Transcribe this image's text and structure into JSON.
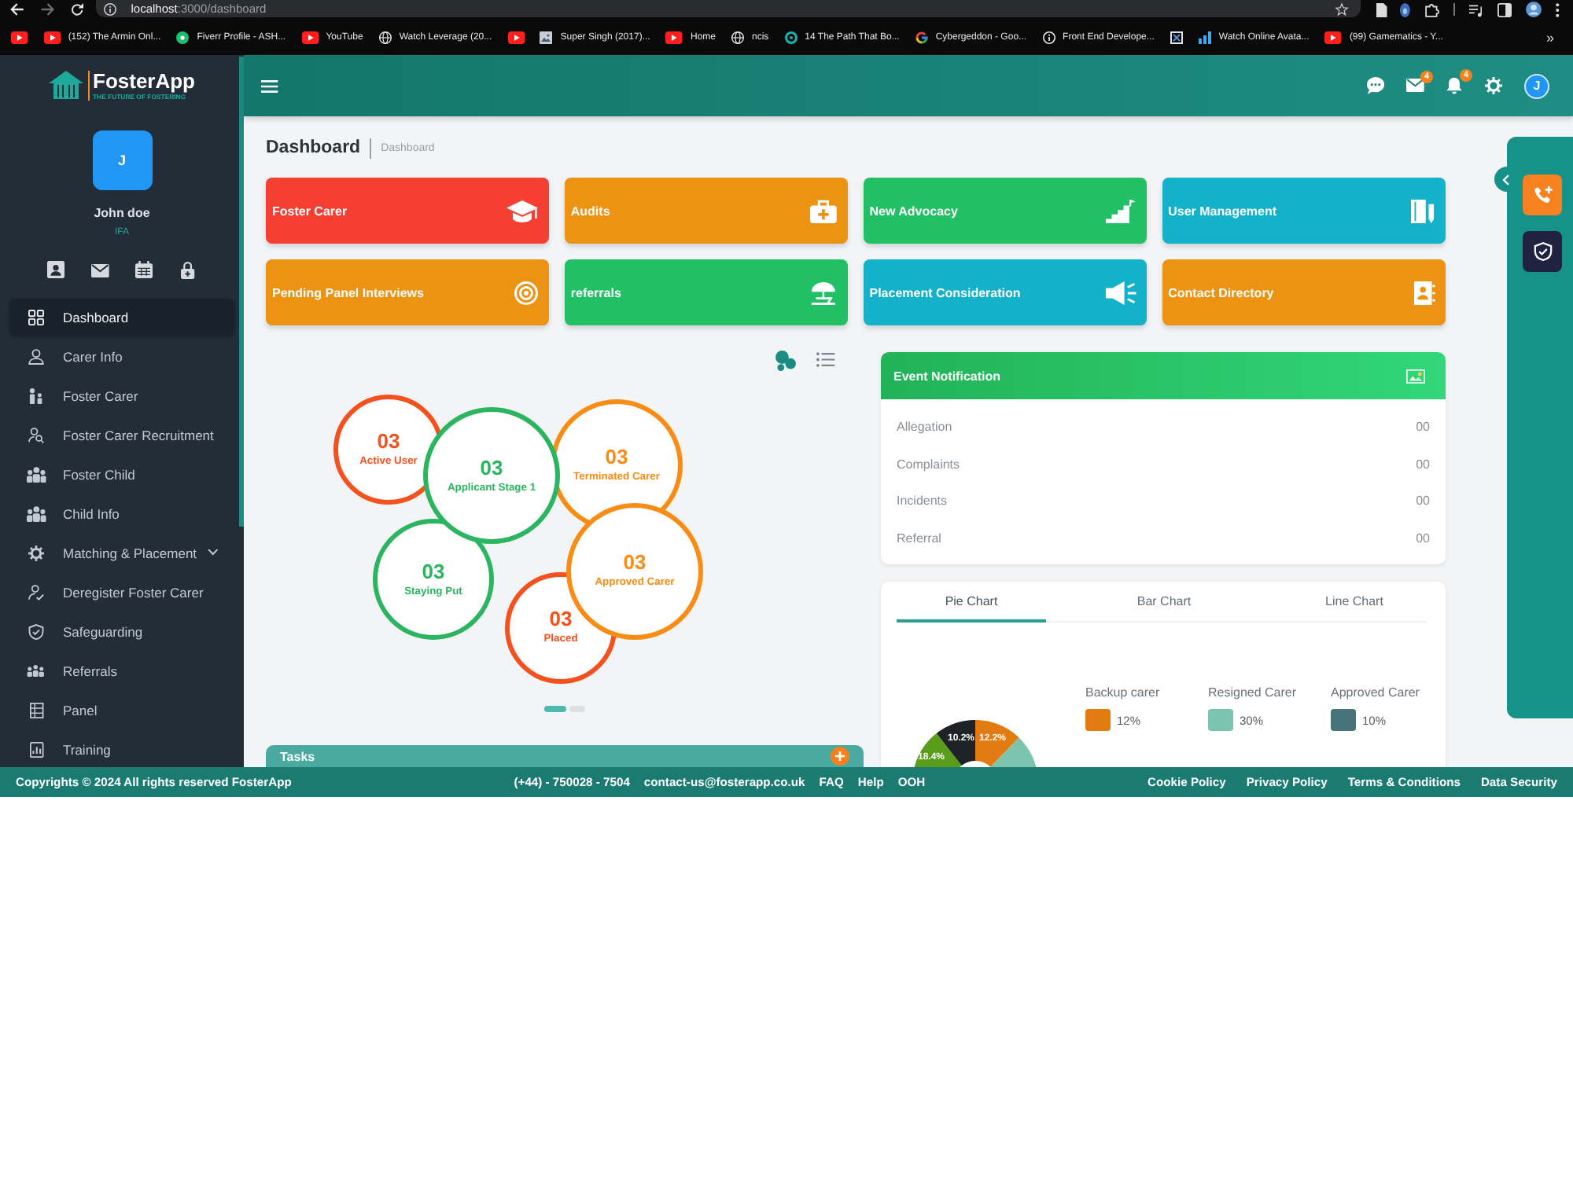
{
  "browser": {
    "url": {
      "host": "localhost",
      "path": ":3000/dashboard"
    },
    "bookmarks": [
      {
        "kind": "play"
      },
      {
        "kind": "play",
        "label": "(152) The Armin Onl..."
      },
      {
        "kind": "dot",
        "label": "Fiverr Profile - ASH..."
      },
      {
        "kind": "play",
        "label": "YouTube"
      },
      {
        "kind": "globe",
        "label": "Watch Leverage (20..."
      },
      {
        "kind": "play"
      },
      {
        "kind": "picture",
        "label": "Super Singh (2017)..."
      },
      {
        "kind": "play",
        "label": "Home"
      },
      {
        "kind": "globe",
        "label": "ncis"
      },
      {
        "kind": "ring",
        "label": "14 The Path That Bo..."
      },
      {
        "kind": "segments",
        "label": "Cybergeddon - Goo..."
      },
      {
        "kind": "info",
        "label": "Front End Develope..."
      },
      {
        "kind": "crossed"
      },
      {
        "kind": "bars",
        "label": "Watch Online Avata..."
      },
      {
        "kind": "play",
        "label": "(99) Gamematics - Y..."
      }
    ],
    "overflow": "»"
  },
  "sidebar": {
    "logo": {
      "name": "FosterApp",
      "tagline": "THE FUTURE OF FOSTERING"
    },
    "user": {
      "initial": "J",
      "name": "John doe",
      "role": "IFA"
    },
    "items": [
      {
        "label": "Dashboard",
        "kind": "grid",
        "selected": true
      },
      {
        "label": "Carer Info",
        "kind": "person",
        "selected": false
      },
      {
        "label": "Foster Carer",
        "kind": "family",
        "selected": false
      },
      {
        "label": "Foster Carer Recruitment",
        "kind": "person-search",
        "selected": false
      },
      {
        "label": "Foster Child",
        "kind": "group",
        "selected": false
      },
      {
        "label": "Child Info",
        "kind": "group",
        "selected": false
      },
      {
        "label": "Matching & Placement",
        "kind": "gear",
        "selected": false,
        "expanded": false
      },
      {
        "label": "Deregister Foster Carer",
        "kind": "person-check",
        "selected": false
      },
      {
        "label": "Safeguarding",
        "kind": "shield",
        "selected": false
      },
      {
        "label": "Referrals",
        "kind": "people",
        "selected": false
      },
      {
        "label": "Panel",
        "kind": "table",
        "selected": false
      },
      {
        "label": "Training",
        "kind": "board",
        "selected": false
      }
    ]
  },
  "header": {
    "icons": [
      {
        "kind": "chat"
      },
      {
        "kind": "mail",
        "badge": "4"
      },
      {
        "kind": "bell",
        "badge": "4"
      },
      {
        "kind": "settings"
      }
    ],
    "avatar": "J"
  },
  "page": {
    "title": "Dashboard",
    "breadcrumb": "Dashboard"
  },
  "tiles": [
    {
      "label": "Foster Carer",
      "color": "#f53f33",
      "kind": "cap"
    },
    {
      "label": "Audits",
      "color": "#ec9314",
      "kind": "kit"
    },
    {
      "label": "New Advocacy",
      "color": "#22c064",
      "kind": "stairs"
    },
    {
      "label": "User Management",
      "color": "#13b1ca",
      "kind": "notebook"
    },
    {
      "label": "Pending Panel Interviews",
      "color": "#ec9314",
      "kind": "target"
    },
    {
      "label": "referrals",
      "color": "#22c064",
      "kind": "umbrella"
    },
    {
      "label": "Placement Consideration",
      "color": "#13b1ca",
      "kind": "megaphone"
    },
    {
      "label": "Contact Directory",
      "color": "#ec9314",
      "kind": "contacts"
    }
  ],
  "bubble_chart": {
    "views": [
      {
        "kind": "bubbles",
        "selected": true
      },
      {
        "kind": "list",
        "selected": false
      }
    ],
    "bubbles": [
      {
        "value": "03",
        "label": "Active User",
        "color": "#f4511e"
      },
      {
        "value": "03",
        "label": "Applicant Stage 1",
        "color": "#2bb560"
      },
      {
        "value": "03",
        "label": "Terminated Carer",
        "color": "#f98c14"
      },
      {
        "value": "03",
        "label": "Staying Put",
        "color": "#2bb560"
      },
      {
        "value": "03",
        "label": "Approved Carer",
        "color": "#f98c14"
      },
      {
        "value": "03",
        "label": "Placed",
        "color": "#f4511e"
      }
    ],
    "pages": [
      {
        "selected": true
      },
      {
        "selected": false
      }
    ]
  },
  "tasks": {
    "title": "Tasks"
  },
  "events": {
    "title": "Event Notification",
    "rows": [
      {
        "label": "Allegation",
        "count": "00"
      },
      {
        "label": "Complaints",
        "count": "00"
      },
      {
        "label": "Incidents",
        "count": "00"
      },
      {
        "label": "Referral",
        "count": "00"
      }
    ]
  },
  "charts": {
    "tabs": [
      {
        "label": "Pie Chart",
        "selected": true
      },
      {
        "label": "Bar Chart",
        "selected": false
      },
      {
        "label": "Line Chart",
        "selected": false
      }
    ],
    "slices": [
      {
        "label": "18.4%",
        "color": "#5a9d1c"
      },
      {
        "label": "10.2%",
        "color": "#1e2327"
      },
      {
        "label": "12.2%",
        "color": "#e27c12"
      },
      {
        "color": "#7cc4ae"
      }
    ],
    "legend": [
      {
        "label": "Backup carer",
        "value": "12%",
        "color": "#e27c12"
      },
      {
        "label": "Resigned Carer",
        "value": "30%",
        "color": "#7cc4ae"
      },
      {
        "label": "Approved Carer",
        "value": "10%",
        "color": "#46747a"
      }
    ]
  },
  "side_rail": {
    "buttons": [
      {
        "kind": "phone-plus",
        "color": "#f5821f"
      },
      {
        "kind": "shield",
        "color": "#1f2240"
      }
    ]
  },
  "footer": {
    "copyright": "Copyrights © 2024 All rights reserved FosterApp",
    "contacts": [
      "(+44) - 750028 - 7504",
      "contact-us@fosterapp.co.uk"
    ],
    "help_links": [
      "FAQ",
      "Help",
      "OOH"
    ],
    "policy_links": [
      "Cookie Policy",
      "Privacy Policy",
      "Terms & Conditions",
      "Data Security"
    ]
  }
}
